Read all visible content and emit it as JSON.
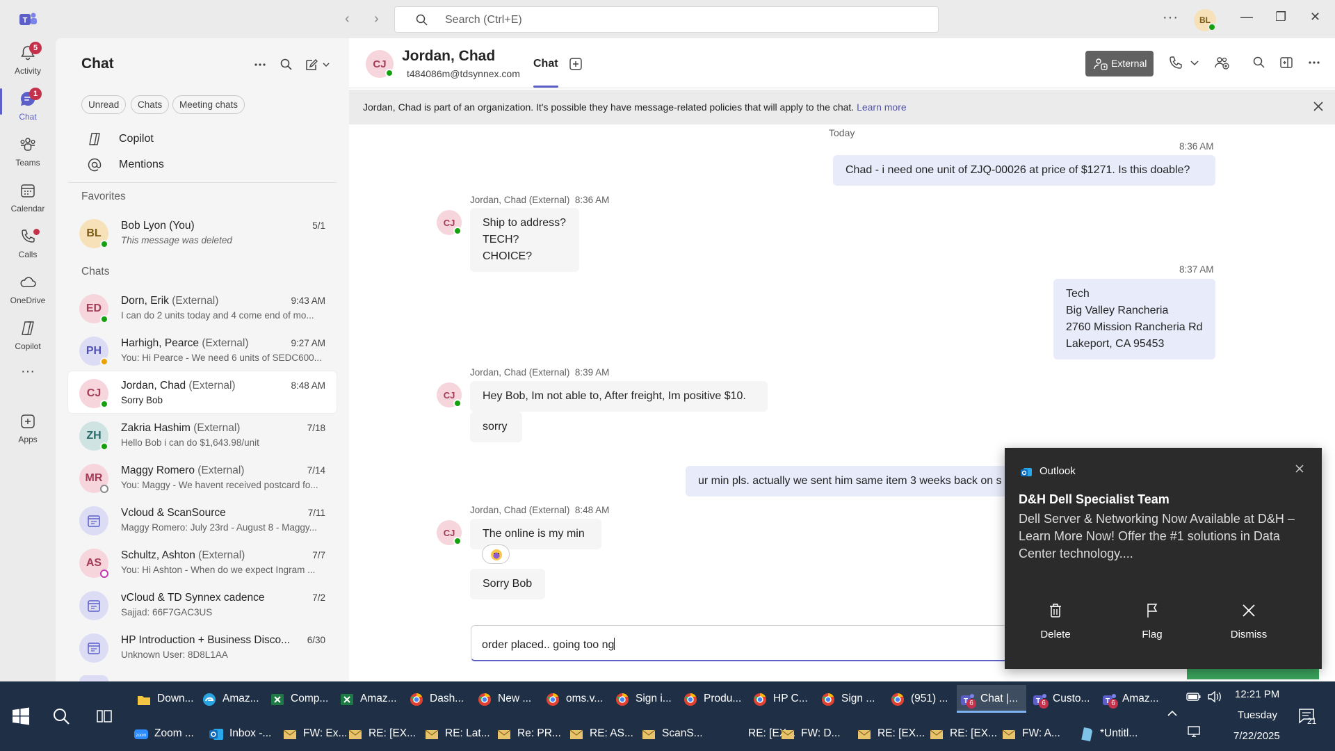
{
  "titlebar": {
    "search_placeholder": "Search (Ctrl+E)",
    "more": "···",
    "user_initials": "BL",
    "minimize": "—",
    "maximize": "❐",
    "close": "✕"
  },
  "rail": [
    {
      "label": "Activity",
      "badge": "5"
    },
    {
      "label": "Chat",
      "badge": "1"
    },
    {
      "label": "Teams"
    },
    {
      "label": "Calendar"
    },
    {
      "label": "Calls"
    },
    {
      "label": "OneDrive"
    },
    {
      "label": "Copilot"
    },
    {
      "label": "···"
    },
    {
      "label": "Apps"
    }
  ],
  "chatlist": {
    "title": "Chat",
    "filters": [
      "Unread",
      "Chats",
      "Meeting chats"
    ],
    "nav": [
      "Copilot",
      "Mentions"
    ],
    "favorites_label": "Favorites",
    "chats_label": "Chats",
    "favorites": [
      {
        "initials": "BL",
        "name": "Bob Lyon (You)",
        "ext": "",
        "preview": "This message was deleted",
        "time": "5/1"
      }
    ],
    "chats": [
      {
        "initials": "ED",
        "name": "Dorn, Erik",
        "ext": "(External)",
        "preview": "I can do 2 units today and 4 come end of mo...",
        "time": "9:43 AM"
      },
      {
        "initials": "PH",
        "name": "Harhigh, Pearce",
        "ext": "(External)",
        "preview": "You: Hi Pearce -  We need 6 units of SEDC600...",
        "time": "9:27 AM"
      },
      {
        "initials": "CJ",
        "name": "Jordan, Chad",
        "ext": "(External)",
        "preview": "Sorry Bob",
        "time": "8:48 AM"
      },
      {
        "initials": "ZH",
        "name": "Zakria Hashim",
        "ext": "(External)",
        "preview": "Hello Bob i can do $1,643.98/unit",
        "time": "7/18"
      },
      {
        "initials": "MR",
        "name": "Maggy Romero",
        "ext": "(External)",
        "preview": "You: Maggy - We havent received postcard fo...",
        "time": "7/14"
      },
      {
        "initials": "",
        "name": "Vcloud & ScanSource",
        "ext": "",
        "preview": "Maggy Romero: July 23rd - August 8 - Maggy...",
        "time": "7/11"
      },
      {
        "initials": "AS",
        "name": "Schultz, Ashton",
        "ext": "(External)",
        "preview": "You: Hi Ashton -  When do we expect Ingram ...",
        "time": "7/7"
      },
      {
        "initials": "",
        "name": "vCloud & TD Synnex cadence",
        "ext": "",
        "preview": "Sajjad: 66F7GAC3US",
        "time": "7/2"
      },
      {
        "initials": "",
        "name": "HP Introduction + Business Disco...",
        "ext": "",
        "preview": "Unknown User: 8D8L1AA",
        "time": "6/30"
      }
    ]
  },
  "conversation": {
    "initials": "CJ",
    "name": "Jordan, Chad",
    "email": "t484086m@tdsynnex.com",
    "tab": "Chat",
    "external_label": "External",
    "banner_text": "Jordan, Chad is part of an organization. It's possible they have message-related policies that will apply to the chat.",
    "banner_link": "Learn more",
    "today_label": "Today",
    "messages": {
      "m1_time": "8:36 AM",
      "m1_text": "Chad -  i need one unit of ZJQ-00026  at price of $1271. Is this doable?",
      "g1_sender": "Jordan, Chad (External)",
      "g1_time": "8:36 AM",
      "g1_line1": "Ship to address?",
      "g1_line2": "TECH? CHOICE?",
      "m2_time": "8:37 AM",
      "m2_line1": "Tech",
      "m2_line2": "Big Valley Rancheria",
      "m2_line3": "2760 Mission Rancheria Rd",
      "m2_line4": "Lakeport, CA 95453",
      "g2_sender": "Jordan, Chad (External)",
      "g2_time": "8:39 AM",
      "g2_text1": "Hey Bob, Im not able to, After freight, Im positive $10.",
      "g2_text2": "sorry",
      "m3_text": "ur min pls. actually we sent him same item 3 weeks back on s",
      "g3_sender": "Jordan, Chad (External)",
      "g3_time": "8:48 AM",
      "g3_text1": "The online is my min",
      "g3_text2": "Sorry Bob"
    },
    "composer_text": "order placed.. going too ng"
  },
  "toast": {
    "app": "Outlook",
    "title": "D&H Dell Specialist Team",
    "body": "Dell Server & Networking Now Available at D&H – Learn More Now! Offer the #1 solutions in Data Center technology....",
    "actions": [
      "Delete",
      "Flag",
      "Dismiss"
    ]
  },
  "taskbar": {
    "row1": [
      {
        "label": "Down...",
        "icon": "folder-icon",
        "color": "#f4c542"
      },
      {
        "label": "Amaz...",
        "icon": "edge-icon",
        "color": "#2aa4e0"
      },
      {
        "label": "Comp...",
        "icon": "excel-icon",
        "color": "#1d7a45"
      },
      {
        "label": "Amaz...",
        "icon": "excel-icon",
        "color": "#1d7a45"
      },
      {
        "label": "Dash...",
        "icon": "chrome-icon",
        "color": "#e34133"
      },
      {
        "label": "New ...",
        "icon": "chrome-icon",
        "color": "#e34133"
      },
      {
        "label": "oms.v...",
        "icon": "chrome-icon",
        "color": "#e34133"
      },
      {
        "label": "Sign i...",
        "icon": "chrome-icon",
        "color": "#e34133"
      },
      {
        "label": "Produ...",
        "icon": "chrome-icon",
        "color": "#e34133"
      },
      {
        "label": "HP C...",
        "icon": "chrome-icon",
        "color": "#e34133"
      },
      {
        "label": "Sign ...",
        "icon": "chrome-icon",
        "color": "#e34133"
      },
      {
        "label": "(951) ...",
        "icon": "chrome-icon",
        "color": "#e34133"
      },
      {
        "label": "Chat |...",
        "icon": "teams-icon",
        "color": "#5b5fc7",
        "badge": "6",
        "active": true
      },
      {
        "label": "Custo...",
        "icon": "teams-icon",
        "color": "#5b5fc7",
        "badge": "6"
      },
      {
        "label": "Amaz...",
        "icon": "teams-icon",
        "color": "#5b5fc7",
        "badge": "6"
      }
    ],
    "row2": [
      {
        "label": "Zoom ...",
        "icon": "zoom-icon",
        "color": "#2d8cff"
      },
      {
        "label": "Inbox -...",
        "icon": "outlook-icon",
        "color": "#0f6cbd"
      },
      {
        "label": "FW: Ex...",
        "icon": "mail-icon",
        "color": "#e8c36b"
      },
      {
        "label": "RE: [EX...",
        "icon": "mail-icon",
        "color": "#e8c36b"
      },
      {
        "label": "RE: Lat...",
        "icon": "mail-icon",
        "color": "#e8c36b"
      },
      {
        "label": "Re: PR...",
        "icon": "mail-icon",
        "color": "#e8c36b"
      },
      {
        "label": "RE: AS...",
        "icon": "mail-icon",
        "color": "#e8c36b"
      },
      {
        "label": "ScanS...",
        "icon": "mail-icon",
        "color": "#e8c36b"
      },
      {
        "label": "RE: [EX...",
        "icon": "",
        "color": ""
      },
      {
        "label": "FW: D...",
        "icon": "mail-icon",
        "color": "#e8c36b"
      },
      {
        "label": "RE: [EX...",
        "icon": "mail-icon",
        "color": "#e8c36b"
      },
      {
        "label": "RE: [EX...",
        "icon": "mail-icon",
        "color": "#e8c36b"
      },
      {
        "label": "FW: A...",
        "icon": "mail-icon",
        "color": "#e8c36b"
      },
      {
        "label": "*Untitl...",
        "icon": "notepad-icon",
        "color": "#7ec4e8"
      }
    ],
    "time": "12:21 PM",
    "day": "Tuesday",
    "date": "7/22/2025",
    "notif_count": "21"
  }
}
